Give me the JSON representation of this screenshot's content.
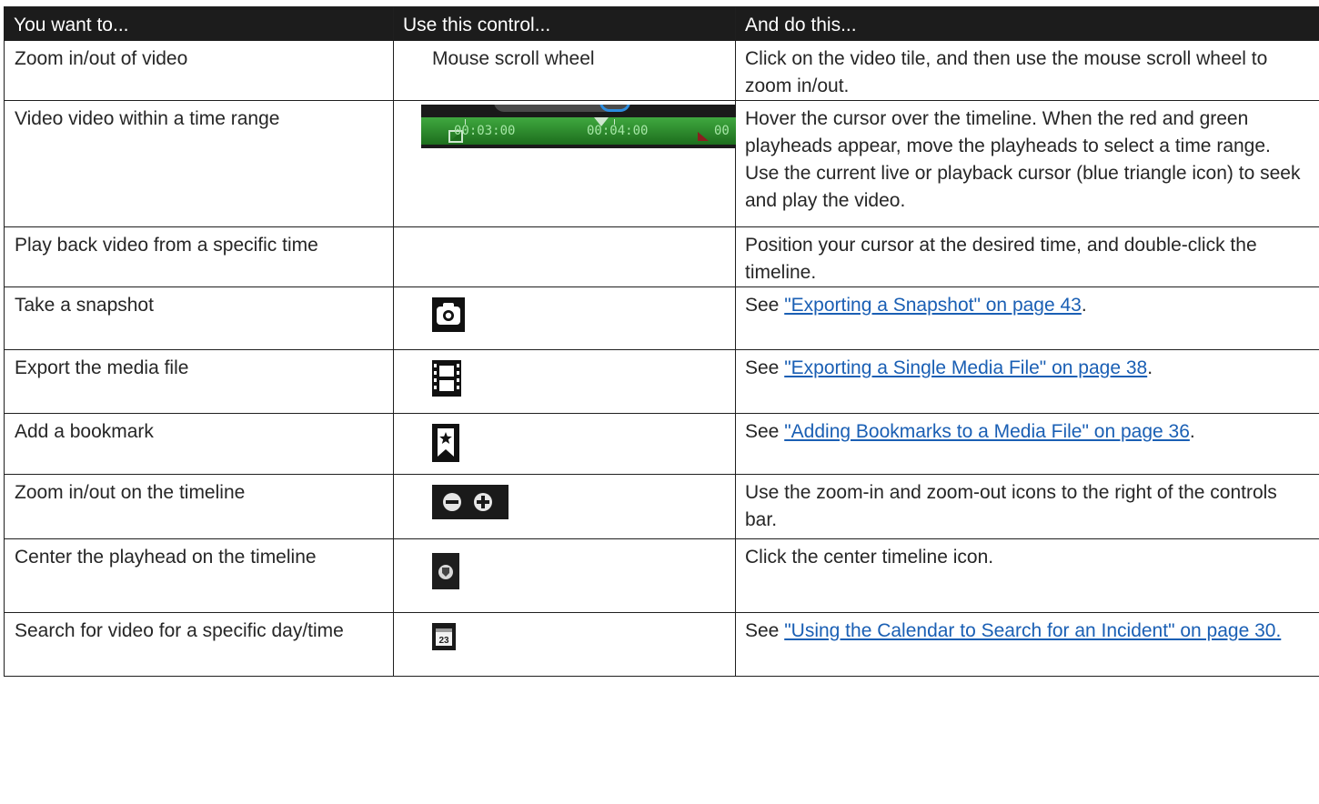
{
  "headers": [
    "You want to...",
    "Use this control...",
    "And do this..."
  ],
  "rows": [
    {
      "want": "Zoom in/out of video",
      "control_text": "Mouse scroll wheel",
      "action": "Click on the video tile, and then use the mouse scroll wheel to zoom in/out."
    },
    {
      "want": "Video video within a time range",
      "control_icon": "timeline-range-icon",
      "timeline_labels": [
        "00:03:00",
        "00:04:00",
        "00"
      ],
      "action": "Hover the cursor over the timeline. When the red and green playheads appear, move the playheads to select a time range. Use the current live or playback cursor (blue triangle icon) to seek and play the video."
    },
    {
      "want": "Play back video from a specific time",
      "action": "Position your cursor at the desired time, and double-click the timeline."
    },
    {
      "want": "Take a snapshot",
      "control_icon": "camera-icon",
      "action_prefix": "See ",
      "action_link": "\"Exporting a Snapshot\" on page 43",
      "action_suffix": "."
    },
    {
      "want": "Export the media file",
      "control_icon": "film-icon",
      "action_prefix": "See ",
      "action_link": "\"Exporting a Single Media File\" on page 38",
      "action_suffix": "."
    },
    {
      "want": "Add a bookmark",
      "control_icon": "bookmark-icon",
      "action_prefix": "See ",
      "action_link": "\"Adding Bookmarks to a Media File\" on page 36",
      "action_suffix": "."
    },
    {
      "want": "Zoom in/out on the timeline",
      "control_icon": "zoom-minus-plus-icon",
      "action": "Use the zoom-in and zoom-out icons to the right of the controls bar."
    },
    {
      "want": "Center the playhead on the timeline",
      "control_icon": "center-timeline-icon",
      "action": "Click the center timeline icon."
    },
    {
      "want": "Search for video for a specific day/time",
      "control_icon": "calendar-icon",
      "calendar_day": "23",
      "action_prefix": "See ",
      "action_link": "\"Using the Calendar to Search for an Incident\" on page 30.",
      "action_suffix": ""
    }
  ]
}
